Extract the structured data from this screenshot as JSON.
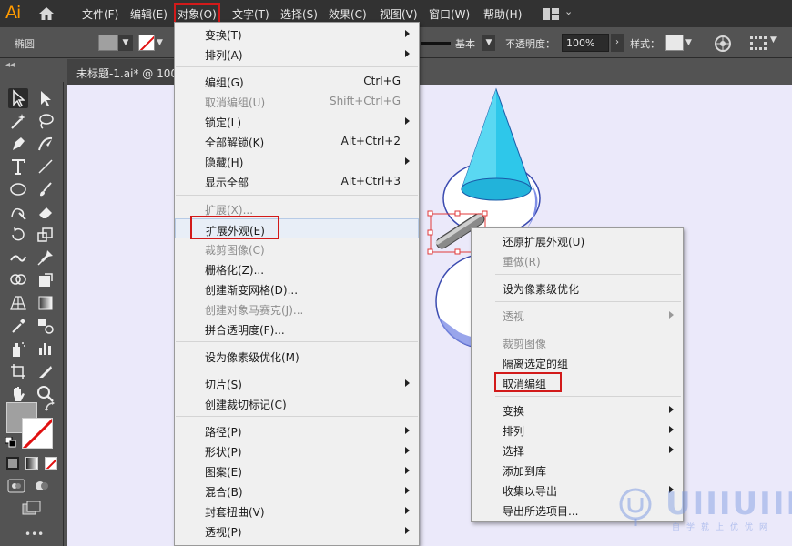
{
  "app": {
    "logo": "Ai"
  },
  "menubar": {
    "items": [
      "文件(F)",
      "编辑(E)",
      "对象(O)",
      "文字(T)",
      "选择(S)",
      "效果(C)",
      "视图(V)",
      "窗口(W)",
      "帮助(H)"
    ]
  },
  "control_bar": {
    "shape_name": "椭圆",
    "stroke_profile": "基本",
    "opacity_label": "不透明度：",
    "opacity_value": "100%",
    "style_label": "样式："
  },
  "document_tab": {
    "title": "未标题-1.ai* @ 100"
  },
  "object_menu": {
    "items": [
      {
        "label": "变换(T)",
        "submenu": true
      },
      {
        "label": "排列(A)",
        "submenu": true
      },
      {
        "label": "编组(G)",
        "shortcut": "Ctrl+G"
      },
      {
        "label": "取消编组(U)",
        "shortcut": "Shift+Ctrl+G",
        "disabled": true
      },
      {
        "label": "锁定(L)",
        "submenu": true
      },
      {
        "label": "全部解锁(K)",
        "shortcut": "Alt+Ctrl+2"
      },
      {
        "label": "隐藏(H)",
        "submenu": true
      },
      {
        "label": "显示全部",
        "shortcut": "Alt+Ctrl+3"
      },
      {
        "label": "扩展(X)...",
        "disabled": true
      },
      {
        "label": "扩展外观(E)",
        "highlighted": true
      },
      {
        "label": "裁剪图像(C)",
        "disabled": true
      },
      {
        "label": "栅格化(Z)..."
      },
      {
        "label": "创建渐变网格(D)..."
      },
      {
        "label": "创建对象马赛克(J)...",
        "disabled": true
      },
      {
        "label": "拼合透明度(F)..."
      },
      {
        "label": "设为像素级优化(M)"
      },
      {
        "label": "切片(S)",
        "submenu": true
      },
      {
        "label": "创建裁切标记(C)"
      },
      {
        "label": "路径(P)",
        "submenu": true
      },
      {
        "label": "形状(P)",
        "submenu": true
      },
      {
        "label": "图案(E)",
        "submenu": true
      },
      {
        "label": "混合(B)",
        "submenu": true
      },
      {
        "label": "封套扭曲(V)",
        "submenu": true
      },
      {
        "label": "透视(P)",
        "submenu": true
      }
    ]
  },
  "context_menu": {
    "items": [
      {
        "label": "还原扩展外观(U)"
      },
      {
        "label": "重做(R)",
        "disabled": true
      },
      {
        "label": "设为像素级优化"
      },
      {
        "label": "透视",
        "submenu": true,
        "disabled": true
      },
      {
        "label": "裁剪图像",
        "disabled": true
      },
      {
        "label": "隔离选定的组"
      },
      {
        "label": "取消编组",
        "highlighted": true
      },
      {
        "label": "变换",
        "submenu": true
      },
      {
        "label": "排列",
        "submenu": true
      },
      {
        "label": "选择",
        "submenu": true
      },
      {
        "label": "添加到库"
      },
      {
        "label": "收集以导出",
        "submenu": true
      },
      {
        "label": "导出所选项目..."
      }
    ]
  },
  "watermark": {
    "text": "UIIIUIII",
    "subtitle": "自学就上优优网"
  },
  "colors": {
    "highlight_box": "#d21a1a",
    "logo": "#ff9a00",
    "canvas": "#ebe9fa",
    "cone": "#2ec7ea",
    "snowman_outline": "#3b4bb0"
  }
}
